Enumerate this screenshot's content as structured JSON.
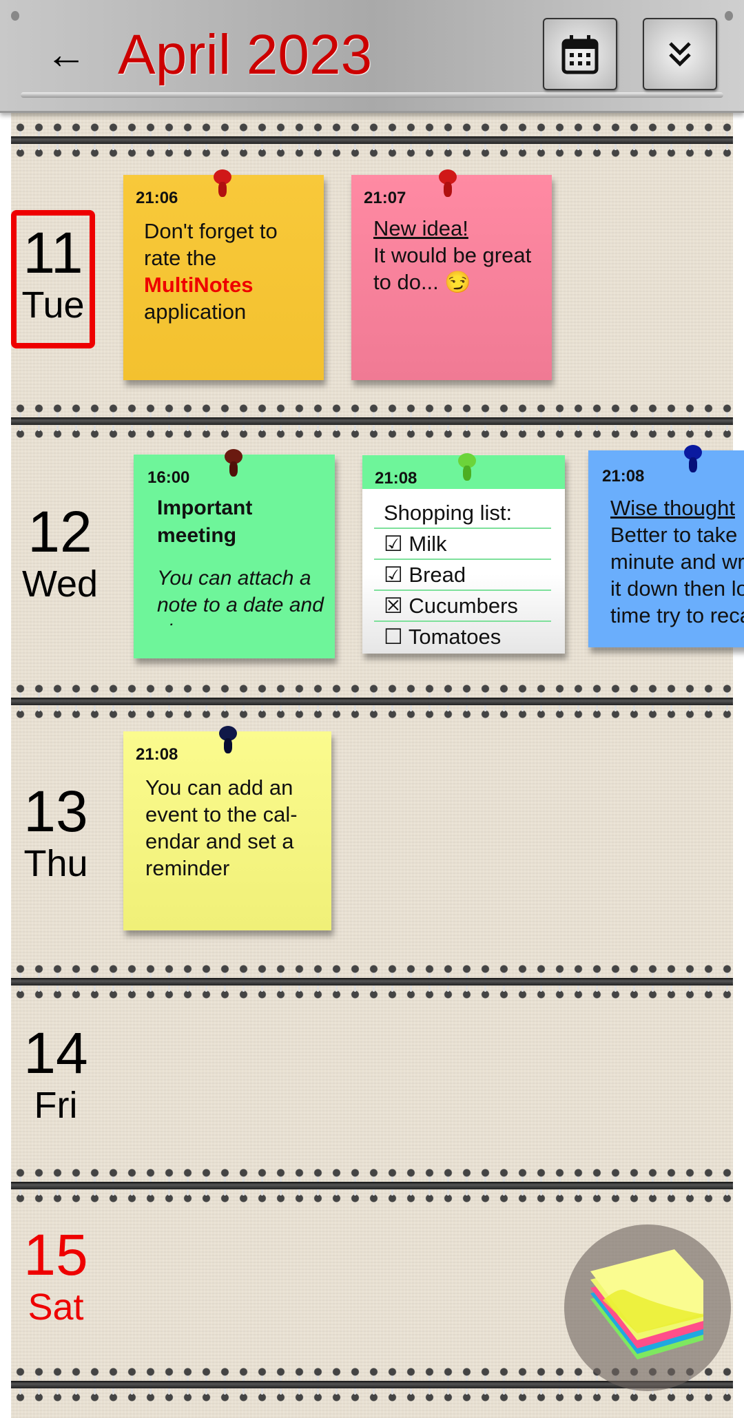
{
  "header": {
    "title": "April 2023",
    "back_icon": "arrow-left-icon",
    "calendar_icon": "calendar-icon",
    "menu_icon": "double-chevron-down-icon"
  },
  "days": [
    {
      "num": "11",
      "weekday": "Tue",
      "today": true
    },
    {
      "num": "12",
      "weekday": "Wed"
    },
    {
      "num": "13",
      "weekday": "Thu"
    },
    {
      "num": "14",
      "weekday": "Fri"
    },
    {
      "num": "15",
      "weekday": "Sat",
      "weekend_color": "#ee0000"
    }
  ],
  "notes": {
    "n1": {
      "time": "21:06",
      "line1": "Don't forget to rate the",
      "highlight": "MultiNotes",
      "line2": "application",
      "color": "#f8c93a"
    },
    "n2": {
      "time": "21:07",
      "heading": "New idea!",
      "text": "It would be great to do... 😏",
      "color": "#ff8aa3"
    },
    "n3": {
      "time": "16:00",
      "heading": "Important meeting",
      "text": "You can attach a note to a date and view your",
      "color": "#6ef59a"
    },
    "n4": {
      "time": "21:08",
      "title": "Shopping list:",
      "items": [
        "☑ Milk",
        "☑ Bread",
        "☒ Cucumbers",
        "☐ Tomatoes"
      ]
    },
    "n5": {
      "time": "21:08",
      "heading": "Wise thought",
      "text": "Better to take a minute and write it down then long time try to recall",
      "color": "#6aaefc"
    },
    "n6": {
      "time": "21:08",
      "text": "You can add an event to the cal-endar and set a reminder",
      "color": "#fafa86"
    }
  },
  "fab": {
    "icon": "sticky-notes-stack-icon"
  }
}
